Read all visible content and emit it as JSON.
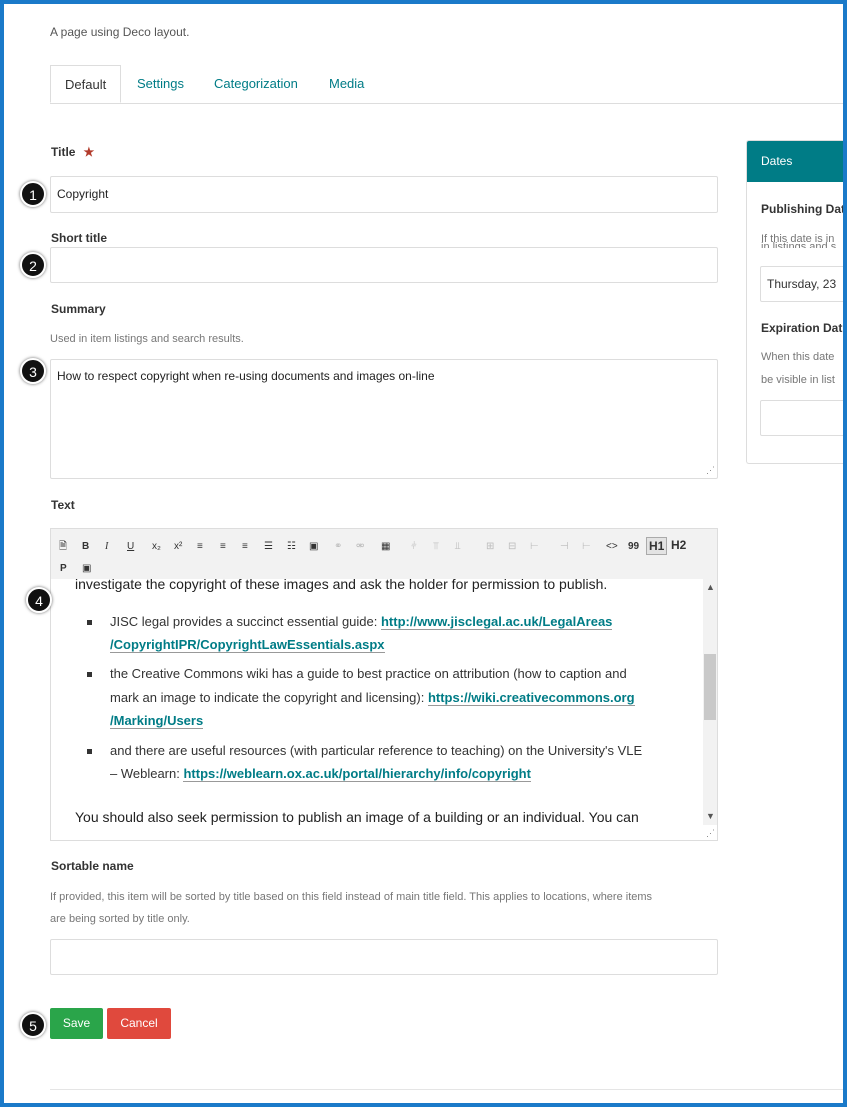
{
  "page": {
    "description": "A page using Deco layout."
  },
  "tabs": [
    {
      "label": "Default",
      "active": true
    },
    {
      "label": "Settings",
      "active": false
    },
    {
      "label": "Categorization",
      "active": false
    },
    {
      "label": "Media",
      "active": false
    }
  ],
  "form": {
    "title": {
      "label": "Title",
      "required_mark": "★",
      "value": "Copyright"
    },
    "short_title": {
      "label": "Short title",
      "value": ""
    },
    "summary": {
      "label": "Summary",
      "help": "Used in item listings and search results.",
      "value": "How to respect copyright when re-using documents and images on-line"
    },
    "text": {
      "label": "Text",
      "toolbar_row1": [
        "🗎",
        "B",
        "I",
        "U",
        "x₂",
        "x²",
        "≡",
        "≡",
        "≡",
        "☰",
        "☷",
        "▣",
        "⚭",
        "⚮",
        "▦",
        "⫩",
        "⫪",
        "⫫",
        "⊞",
        "⊟",
        "⊢",
        "⊣",
        "⊢",
        "<>",
        "99",
        "H1",
        "H2"
      ],
      "toolbar_row2": [
        "P",
        "▣"
      ],
      "content": {
        "line1": "investigate the copyright of these images and ask the holder for permission to publish.",
        "item1_text": "JISC legal provides a succinct essential guide: ",
        "item1_link_a": "http://www.jisclegal.ac.uk/LegalAreas",
        "item1_link_b": "/CopyrightIPR/CopyrightLawEssentials.aspx",
        "item2_text_a": "the Creative Commons wiki has a guide to best practice on attribution (how to caption and",
        "item2_text_b": "mark an image to indicate the copyright and licensing): ",
        "item2_link_a": "https://wiki.creativecommons.org",
        "item2_link_b": "/Marking/Users",
        "item3_text_a": "and there are useful resources (with particular reference to teaching) on the University's VLE",
        "item3_text_b": "– Weblearn: ",
        "item3_link": "https://weblearn.ox.ac.uk/portal/hierarchy/info/copyright",
        "line_last": "You should also seek permission to publish an image of a building or an individual. You can"
      }
    },
    "sortable_name": {
      "label": "Sortable name",
      "help_line1": "If provided, this item will be sorted by title based on this field instead of main title field. This applies to locations, where items",
      "help_line2": "are being sorted by title only.",
      "value": ""
    }
  },
  "buttons": {
    "save": "Save",
    "cancel": "Cancel"
  },
  "sidebar": {
    "header": "Dates",
    "publishing_label": "Publishing Dat",
    "publishing_help_a": "If this date is in",
    "publishing_help_b": "in listings and s",
    "publishing_value": "Thursday, 23",
    "expiration_label": "Expiration Dat",
    "expiration_help_a": "When this date",
    "expiration_help_b": "be visible in list",
    "expiration_value": ""
  },
  "markers": [
    "1",
    "2",
    "3",
    "4",
    "5"
  ],
  "colors": {
    "accent": "#007c86",
    "save": "#2aa54a",
    "cancel": "#e0493d",
    "frame": "#1a7ac9",
    "required": "#b23b2b"
  }
}
